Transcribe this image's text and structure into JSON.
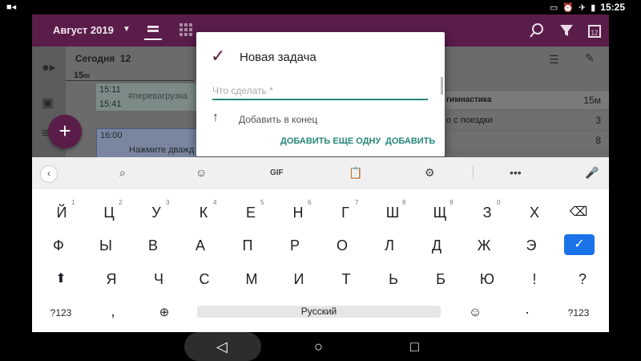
{
  "status_bar": {
    "time": "15:25"
  },
  "app_bar": {
    "month": "Август 2019"
  },
  "calendar": {
    "today_label": "Сегодня",
    "today_day": "12",
    "hour": "15",
    "hour_min": "00",
    "event1_start": "15:11",
    "event1_end": "15:41",
    "event1_tag": "#перевагрузка",
    "event2_start": "16:00",
    "event2_text": "Нажмите дважд",
    "right_list": [
      {
        "text": "гимнастика",
        "value": "15м"
      },
      {
        "text": "о с поездки",
        "value": "3"
      },
      {
        "text": "",
        "value": "8"
      }
    ]
  },
  "dialog": {
    "title": "Новая задача",
    "input_placeholder": "Что сделать *",
    "add_to_end": "Добавить в конец",
    "add_another": "ДОБАВИТЬ ЕЩЕ ОДНУ",
    "add": "ДОБАВИТЬ"
  },
  "keyboard": {
    "toolbar": {
      "gif": "GIF"
    },
    "row1": [
      {
        "k": "Й",
        "h": "1"
      },
      {
        "k": "Ц",
        "h": "2"
      },
      {
        "k": "У",
        "h": "3"
      },
      {
        "k": "К",
        "h": "4"
      },
      {
        "k": "Е",
        "h": "5"
      },
      {
        "k": "Н",
        "h": "6"
      },
      {
        "k": "Г",
        "h": "7"
      },
      {
        "k": "Ш",
        "h": "8"
      },
      {
        "k": "Щ",
        "h": "9"
      },
      {
        "k": "З",
        "h": "0"
      },
      {
        "k": "Х",
        "h": ""
      }
    ],
    "row2": [
      "Ф",
      "Ы",
      "В",
      "А",
      "П",
      "Р",
      "О",
      "Л",
      "Д",
      "Ж",
      "Э"
    ],
    "row3": [
      "Я",
      "Ч",
      "С",
      "М",
      "И",
      "Т",
      "Ь",
      "Б",
      "Ю",
      "!",
      "?"
    ],
    "bottom": {
      "sym": "?123",
      "comma": ",",
      "space": "Русский",
      "period": "·",
      "sym2": "?123"
    }
  }
}
